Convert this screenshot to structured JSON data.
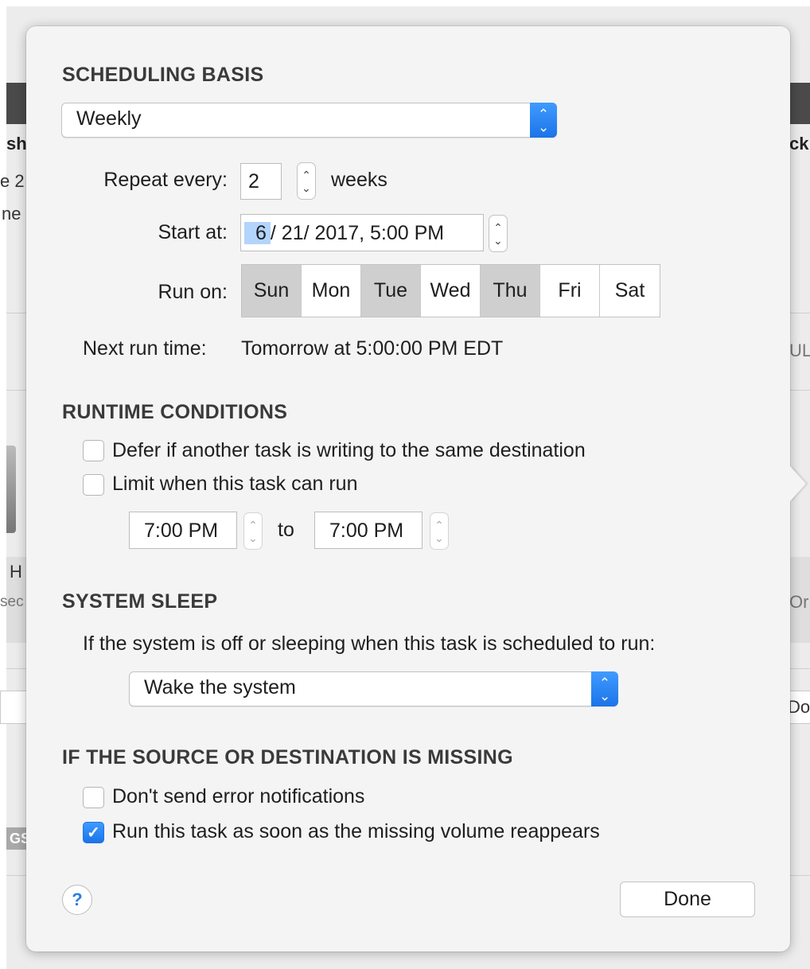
{
  "background": {
    "fragments": {
      "left_1": "sh",
      "left_2": "e 2",
      "left_3": "ne",
      "left_4": "H",
      "left_5": "sec",
      "right_1": "ck",
      "right_2": "ULE",
      "right_3": "Or",
      "right_4": "Do",
      "badge": "GS"
    }
  },
  "scheduling": {
    "title": "SCHEDULING BASIS",
    "basis_value": "Weekly",
    "repeat_label": "Repeat every:",
    "repeat_value": "2",
    "repeat_unit": "weeks",
    "start_label": "Start at:",
    "start_month": "6",
    "start_rest": "/ 21/ 2017,   5:00 PM",
    "run_on_label": "Run on:",
    "days": [
      {
        "label": "Sun",
        "selected": true
      },
      {
        "label": "Mon",
        "selected": false
      },
      {
        "label": "Tue",
        "selected": true
      },
      {
        "label": "Wed",
        "selected": false
      },
      {
        "label": "Thu",
        "selected": true
      },
      {
        "label": "Fri",
        "selected": false
      },
      {
        "label": "Sat",
        "selected": false
      }
    ],
    "next_run_label": "Next run time:",
    "next_run_value": "Tomorrow at 5:00:00 PM EDT"
  },
  "runtime": {
    "title": "RUNTIME CONDITIONS",
    "defer_label": "Defer if another task is writing to the same destination",
    "defer_checked": false,
    "limit_label": "Limit when this task can run",
    "limit_checked": false,
    "from_time": "7:00 PM",
    "to_label": "to",
    "to_time": "7:00 PM"
  },
  "sleep": {
    "title": "SYSTEM SLEEP",
    "description": "If the system is off or sleeping when this task is scheduled to run:",
    "action_value": "Wake the system"
  },
  "missing": {
    "title": "IF THE SOURCE OR DESTINATION IS MISSING",
    "no_notify_label": "Don't send error notifications",
    "no_notify_checked": false,
    "run_reappear_label": "Run this task as soon as the missing volume reappears",
    "run_reappear_checked": true
  },
  "footer": {
    "help_label": "?",
    "done_label": "Done"
  },
  "colors": {
    "accent": "#1b74e8",
    "day_selected": "#cfcfcf",
    "popover_bg": "#f4f4f4"
  },
  "icons": {
    "popup_chevron": "up-down-chevron-icon",
    "stepper": "stepper-arrows-icon",
    "checkmark": "checkmark-icon",
    "help": "question-mark-icon"
  }
}
